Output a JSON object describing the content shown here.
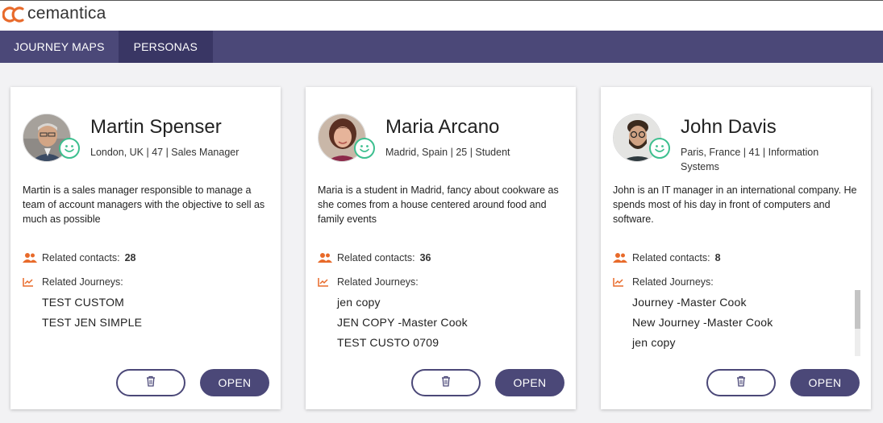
{
  "app": {
    "brand": "cemantica"
  },
  "nav": {
    "tabs": [
      {
        "label": "JOURNEY MAPS"
      },
      {
        "label": "PERSONAS"
      }
    ],
    "active": "PERSONAS"
  },
  "labels": {
    "related_contacts": "Related contacts:",
    "related_journeys": "Related Journeys:",
    "open": "OPEN"
  },
  "colors": {
    "nav_bg": "#4b4878",
    "nav_active": "#393664",
    "accent_orange": "#e86a2a",
    "smile_green": "#3dbf8f"
  },
  "personas": [
    {
      "name": "Martin Spenser",
      "meta": "London, UK | 47 | Sales Manager",
      "description": "Martin is a sales manager responsible to manage a team of account managers with the objective to sell as much as possible",
      "contacts": "28",
      "journeys": [
        "TEST CUSTOM",
        "TEST JEN SIMPLE"
      ]
    },
    {
      "name": "Maria Arcano",
      "meta": "Madrid, Spain | 25 | Student",
      "description": "Maria is a student in Madrid, fancy about cookware as she comes from a house centered around food and family events",
      "contacts": "36",
      "journeys": [
        "jen copy",
        "JEN COPY -Master Cook",
        "TEST CUSTO 0709"
      ]
    },
    {
      "name": "John Davis",
      "meta": "Paris, France | 41 | Information Systems",
      "description": "John is an IT manager in an international company. He spends most of his day in front of computers and software.",
      "contacts": "8",
      "journeys": [
        "Journey -Master Cook",
        "New Journey -Master Cook",
        "jen copy"
      ]
    }
  ]
}
